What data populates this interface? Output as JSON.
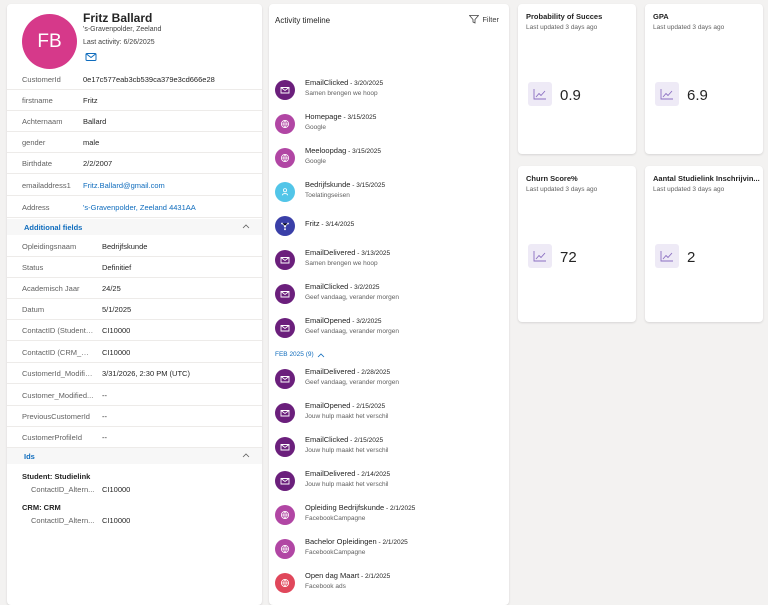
{
  "profile": {
    "initials": "FB",
    "name": "Fritz Ballard",
    "location": "'s-Gravenpolder, Zeeland",
    "last_activity": "Last activity: 6/26/2025",
    "fields": [
      {
        "label": "CustomerId",
        "value": "0e17c577eab3cb539ca379e3cd666e28"
      },
      {
        "label": "firstname",
        "value": "Fritz"
      },
      {
        "label": "Achternaam",
        "value": "Ballard"
      },
      {
        "label": "gender",
        "value": "male"
      },
      {
        "label": "Birthdate",
        "value": "2/2/2007"
      },
      {
        "label": "emailaddress1",
        "value": "Fritz.Ballard@gmail.com"
      },
      {
        "label": "Address",
        "value": "'s-Gravenpolder, Zeeland 4431AA"
      }
    ],
    "additional_title": "Additional fields",
    "additional": [
      {
        "label": "Opleidingsnaam",
        "value": "Bedrijfskunde"
      },
      {
        "label": "Status",
        "value": "Definitief"
      },
      {
        "label": "Academisch Jaar",
        "value": "24/25"
      },
      {
        "label": "Datum",
        "value": "5/1/2025"
      },
      {
        "label": "ContactID (Student_...",
        "value": "CI10000"
      },
      {
        "label": "ContactID (CRM_CR...",
        "value": "CI10000"
      },
      {
        "label": "CustomerId_Modifie...",
        "value": "3/31/2026, 2:30 PM (UTC)"
      },
      {
        "label": "Customer_Modified...",
        "value": "--"
      },
      {
        "label": "PreviousCustomerId",
        "value": "--"
      },
      {
        "label": "CustomerProfileId",
        "value": "--"
      }
    ],
    "ids_title": "Ids",
    "id_groups": [
      {
        "name": "Student: Studielink",
        "label": "ContactID_Altern...",
        "value": "CI10000"
      },
      {
        "name": "CRM: CRM",
        "label": "ContactID_Altern...",
        "value": "CI10000"
      }
    ]
  },
  "timeline": {
    "title": "Activity timeline",
    "filter_label": "Filter",
    "month_label": "FEB 2025 (9)",
    "items": [
      {
        "title": "EmailClicked",
        "date": " - 3/20/2025",
        "sub": "Samen brengen we hoop",
        "icon": "mail-icon",
        "color": "#6b1f7c"
      },
      {
        "title": "Homepage",
        "date": " - 3/15/2025",
        "sub": "Google",
        "icon": "globe-icon",
        "color": "#b146a4"
      },
      {
        "title": "Meeloopdag",
        "date": " - 3/15/2025",
        "sub": "Google",
        "icon": "globe-icon",
        "color": "#b146a4"
      },
      {
        "title": "Bedrijfskunde",
        "date": " - 3/15/2025",
        "sub": "Toelatingseisen",
        "icon": "person-icon",
        "color": "#52c5e8"
      },
      {
        "title": "Fritz",
        "date": " - 3/14/2025",
        "sub": "",
        "icon": "network-icon",
        "color": "#3a3fa8"
      },
      {
        "title": "EmailDelivered",
        "date": " - 3/13/2025",
        "sub": "Samen brengen we hoop",
        "icon": "mail-icon",
        "color": "#6b1f7c"
      },
      {
        "title": "EmailClicked",
        "date": " - 3/2/2025",
        "sub": "Geef vandaag, verander morgen",
        "icon": "mail-icon",
        "color": "#6b1f7c"
      },
      {
        "title": "EmailOpened",
        "date": " - 3/2/2025",
        "sub": "Geef vandaag, verander morgen",
        "icon": "mail-icon",
        "color": "#6b1f7c"
      },
      {
        "title": "EmailDelivered",
        "date": " - 2/28/2025",
        "sub": "Geef vandaag, verander morgen",
        "icon": "mail-icon",
        "color": "#6b1f7c"
      },
      {
        "title": "EmailOpened",
        "date": " - 2/15/2025",
        "sub": "Jouw hulp maakt het verschil",
        "icon": "mail-icon",
        "color": "#6b1f7c"
      },
      {
        "title": "EmailClicked",
        "date": " - 2/15/2025",
        "sub": "Jouw hulp maakt het verschil",
        "icon": "mail-icon",
        "color": "#6b1f7c"
      },
      {
        "title": "EmailDelivered",
        "date": " - 2/14/2025",
        "sub": "Jouw hulp maakt het verschil",
        "icon": "mail-icon",
        "color": "#6b1f7c"
      },
      {
        "title": "Opleiding Bedrijfskunde",
        "date": " - 2/1/2025",
        "sub": "FacebookCampagne",
        "icon": "globe-icon",
        "color": "#b146a4"
      },
      {
        "title": "Bachelor Opleidingen",
        "date": " - 2/1/2025",
        "sub": "FacebookCampagne",
        "icon": "globe-icon",
        "color": "#b146a4"
      },
      {
        "title": "Open dag Maart",
        "date": " - 2/1/2025",
        "sub": "Facebook ads",
        "icon": "globe-icon",
        "color": "#e0475b"
      }
    ]
  },
  "kpis": [
    {
      "title": "Probability of Succes",
      "updated": "Last updated 3 days ago",
      "value": "0.9"
    },
    {
      "title": "GPA",
      "updated": "Last updated 3 days ago",
      "value": "6.9"
    },
    {
      "title": "Churn Score%",
      "updated": "Last updated 3 days ago",
      "value": "72"
    },
    {
      "title": "Aantal Studielink Inschrijvin...",
      "updated": "Last updated 3 days ago",
      "value": "2"
    }
  ]
}
